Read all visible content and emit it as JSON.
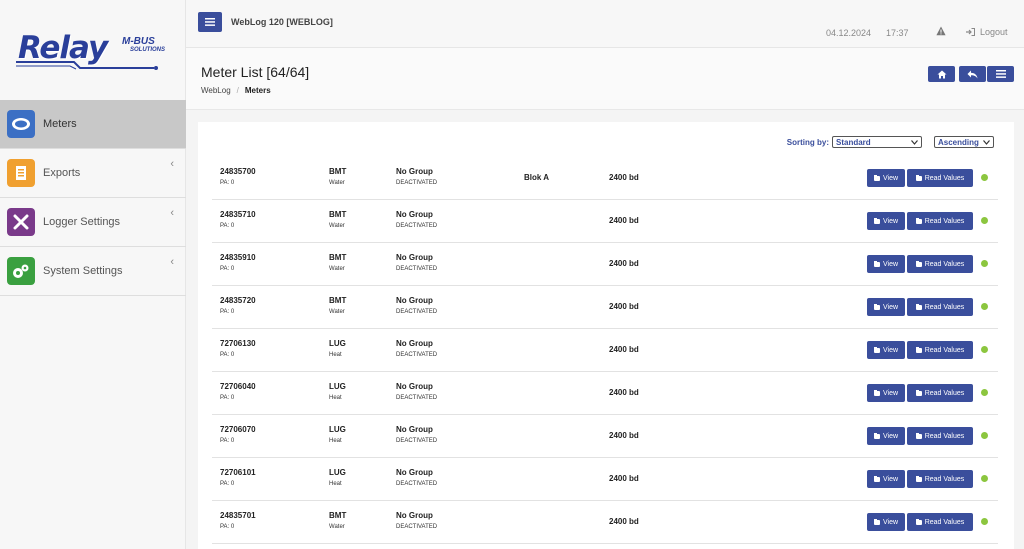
{
  "app": {
    "title": "WebLog 120 [WEBLOG]",
    "date": "04.12.2024",
    "time": "17:37",
    "logout_label": "Logout"
  },
  "logo": {
    "main": "Relay",
    "sub": "M-BUS",
    "sub2": "SOLUTIONS"
  },
  "sidebar": {
    "items": [
      {
        "label": "Meters",
        "icon": "meter-icon",
        "color": "#3b6fc4"
      },
      {
        "label": "Exports",
        "icon": "export-icon",
        "color": "#f0a030"
      },
      {
        "label": "Logger Settings",
        "icon": "tools-icon",
        "color": "#7a3a8a"
      },
      {
        "label": "System Settings",
        "icon": "gears-icon",
        "color": "#3aa040"
      }
    ]
  },
  "page": {
    "title": "Meter List [64/64]",
    "breadcrumb": [
      "WebLog",
      "Meters"
    ],
    "breadcrumb_sep": "/"
  },
  "sort": {
    "label": "Sorting by:",
    "field": "Standard",
    "order": "Ascending"
  },
  "buttons": {
    "view": "View",
    "read": "Read Values"
  },
  "colors": {
    "accent": "#3a4e9c",
    "status_ok": "#8cc63f"
  },
  "meters": [
    {
      "id": "24835700",
      "pa": "PA: 0",
      "maker": "BMT",
      "medium": "Water",
      "group": "No Group",
      "state": "DEACTIVATED",
      "location": "Blok A",
      "baud": "2400 bd"
    },
    {
      "id": "24835710",
      "pa": "PA: 0",
      "maker": "BMT",
      "medium": "Water",
      "group": "No Group",
      "state": "DEACTIVATED",
      "location": "",
      "baud": "2400 bd"
    },
    {
      "id": "24835910",
      "pa": "PA: 0",
      "maker": "BMT",
      "medium": "Water",
      "group": "No Group",
      "state": "DEACTIVATED",
      "location": "",
      "baud": "2400 bd"
    },
    {
      "id": "24835720",
      "pa": "PA: 0",
      "maker": "BMT",
      "medium": "Water",
      "group": "No Group",
      "state": "DEACTIVATED",
      "location": "",
      "baud": "2400 bd"
    },
    {
      "id": "72706130",
      "pa": "PA: 0",
      "maker": "LUG",
      "medium": "Heat",
      "group": "No Group",
      "state": "DEACTIVATED",
      "location": "",
      "baud": "2400 bd"
    },
    {
      "id": "72706040",
      "pa": "PA: 0",
      "maker": "LUG",
      "medium": "Heat",
      "group": "No Group",
      "state": "DEACTIVATED",
      "location": "",
      "baud": "2400 bd"
    },
    {
      "id": "72706070",
      "pa": "PA: 0",
      "maker": "LUG",
      "medium": "Heat",
      "group": "No Group",
      "state": "DEACTIVATED",
      "location": "",
      "baud": "2400 bd"
    },
    {
      "id": "72706101",
      "pa": "PA: 0",
      "maker": "LUG",
      "medium": "Heat",
      "group": "No Group",
      "state": "DEACTIVATED",
      "location": "",
      "baud": "2400 bd"
    },
    {
      "id": "24835701",
      "pa": "PA: 0",
      "maker": "BMT",
      "medium": "Water",
      "group": "No Group",
      "state": "DEACTIVATED",
      "location": "",
      "baud": "2400 bd"
    }
  ]
}
